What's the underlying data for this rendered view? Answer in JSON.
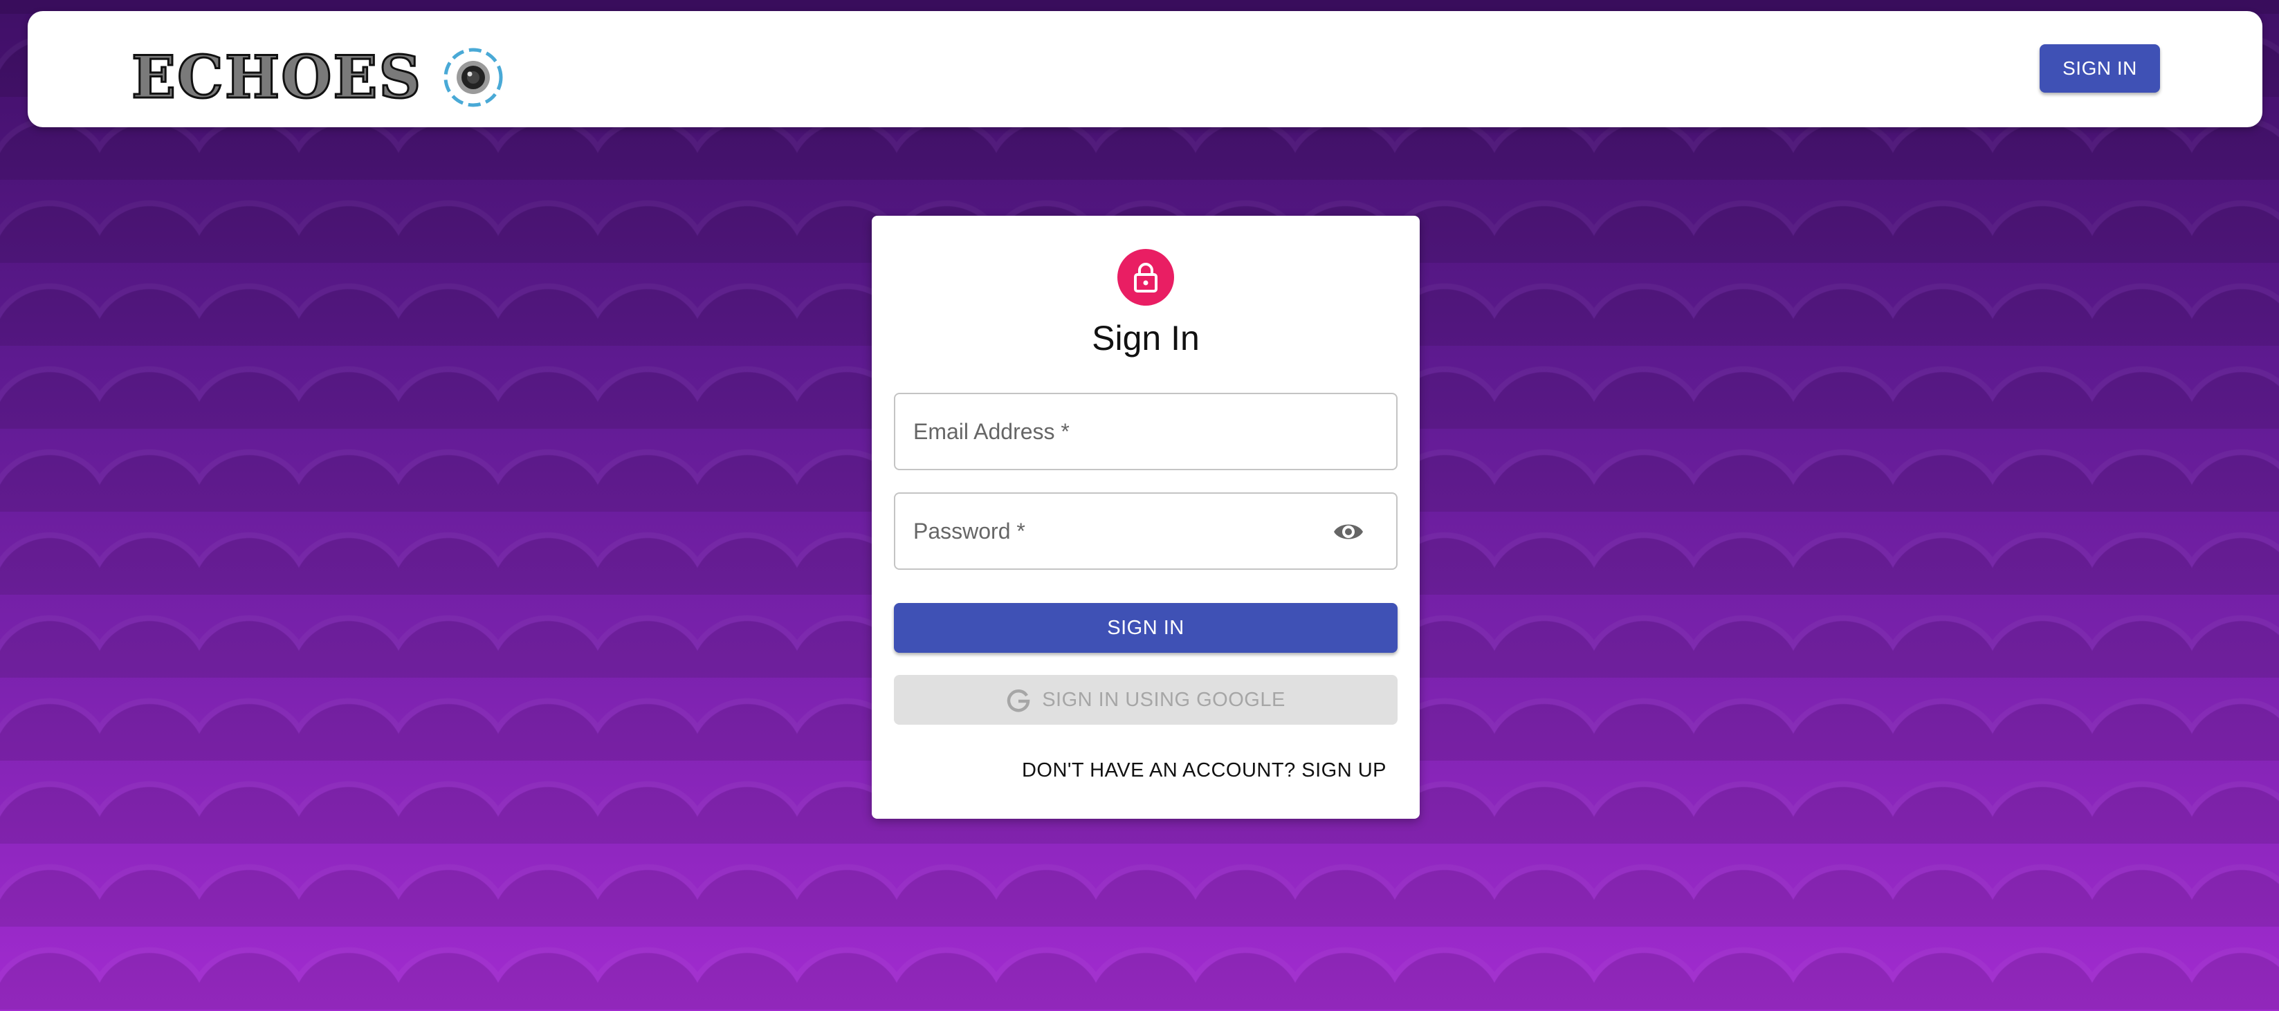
{
  "app": {
    "logo_text": "ECHOES"
  },
  "navbar": {
    "signin_label": "SIGN IN"
  },
  "signin_card": {
    "title": "Sign In",
    "email_label": "Email Address *",
    "password_label": "Password *",
    "signin_button": "SIGN IN",
    "google_button": "SIGN IN USING GOOGLE",
    "signup_link": "DON'T HAVE AN ACCOUNT? SIGN UP"
  },
  "icons": {
    "logo": "camera-lens-icon",
    "avatar": "lock-icon",
    "password_toggle": "eye-icon",
    "google": "google-g-icon"
  },
  "colors": {
    "primary": "#3f51b5",
    "avatar": "#e91e63",
    "disabled_bg": "#e0e0e0",
    "disabled_text": "#a6a6a6"
  }
}
